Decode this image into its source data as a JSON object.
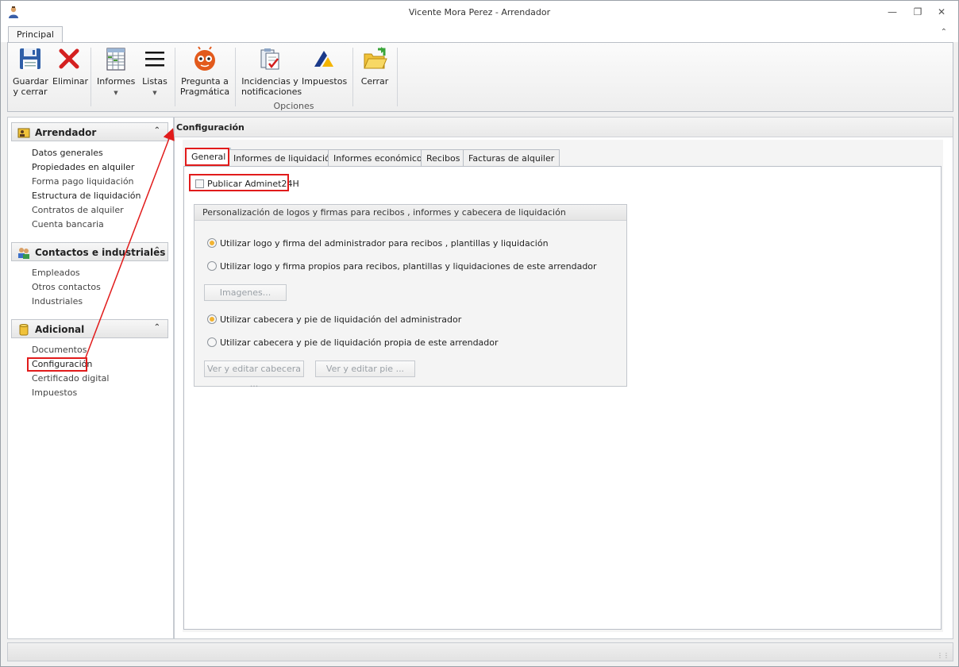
{
  "window": {
    "title": "Vicente Mora Perez - Arrendador",
    "minimize_icon": "minimize-icon",
    "restore_icon": "restore-icon",
    "close_icon": "close-icon"
  },
  "ribbon": {
    "tab": "Principal",
    "buttons": {
      "guardar": "Guardar\ny cerrar",
      "eliminar": "Eliminar",
      "informes": "Informes",
      "listas": "Listas",
      "pregunta": "Pregunta a\nPragmática",
      "incidencias": "Incidencias y\nnotificaciones",
      "impuestos": "Impuestos",
      "cerrar": "Cerrar"
    },
    "group_opciones": "Opciones"
  },
  "nav": {
    "groups": [
      {
        "title": "Arrendador",
        "items": [
          "Datos generales",
          "Propiedades en alquiler",
          "Forma pago liquidación",
          "Estructura de liquidación",
          "Contratos de alquiler",
          "Cuenta bancaria"
        ]
      },
      {
        "title": "Contactos e industriales",
        "items": [
          "Empleados",
          "Otros contactos",
          "Industriales"
        ]
      },
      {
        "title": "Adicional",
        "items": [
          "Documentos",
          "Configuración",
          "Certificado digital",
          "Impuestos"
        ]
      }
    ]
  },
  "content": {
    "title": "Configuración",
    "tabs": [
      "General",
      "Informes de liquidación",
      "Informes económicos",
      "Recibos",
      "Facturas de alquiler"
    ],
    "active_tab": "General",
    "publicar_label": "Publicar Adminet24H",
    "publicar_checked": false,
    "group_title": "Personalización de logos y firmas para recibos , informes y cabecera de liquidación",
    "radio_logo_admin": "Utilizar logo y firma del administrador para recibos , plantillas y liquidación",
    "radio_logo_propio": "Utilizar logo y firma propios para recibos, plantillas y liquidaciones de este arrendador",
    "imagenes_button": "Imagenes...",
    "radio_cab_admin": "Utilizar cabecera y pie de liquidación del administrador",
    "radio_cab_propia": "Utilizar cabecera y pie de liquidación propia de este arrendador",
    "ver_cabecera_button": "Ver y editar cabecera ...",
    "ver_pie_button": "Ver y editar pie ..."
  },
  "colors": {
    "highlight": "#e11b1b",
    "radio_selected": "#f2b331"
  }
}
